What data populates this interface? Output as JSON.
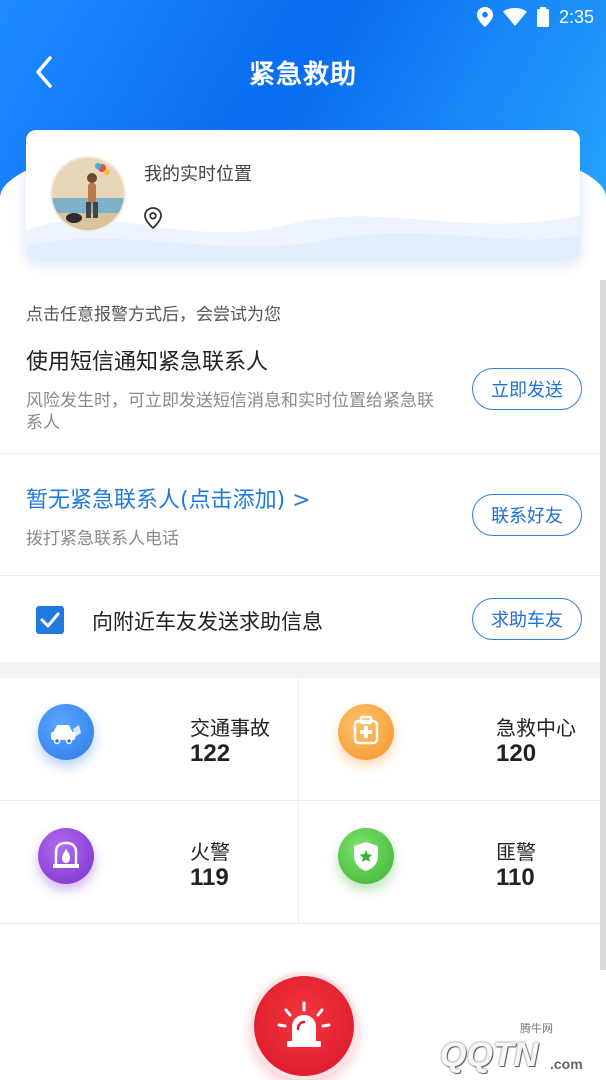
{
  "status_bar": {
    "time": "2:35",
    "icons": [
      "location-icon",
      "wifi-icon",
      "battery-icon"
    ]
  },
  "header": {
    "title": "紧急救助",
    "back_icon": "chevron-left-icon"
  },
  "location_card": {
    "title": "我的实时位置",
    "address": ""
  },
  "notice": "点击任意报警方式后，会尝试为您",
  "sms_row": {
    "title": "使用短信通知紧急联系人",
    "subtitle": "风险发生时，可立即发送短信消息和实时位置给紧急联系人",
    "button": "立即发送"
  },
  "contact_row": {
    "title": "暂无紧急联系人(点击添加)  >",
    "subtitle": "拨打紧急联系人电话",
    "button": "联系好友"
  },
  "nearby_row": {
    "checked": true,
    "label": "向附近车友发送求助信息",
    "button": "求助车友"
  },
  "services": [
    {
      "name": "交通事故",
      "number": "122",
      "icon": "car-accident-icon",
      "color": "#3a8ef0"
    },
    {
      "name": "急救中心",
      "number": "120",
      "icon": "first-aid-icon",
      "color": "#f6a13a"
    },
    {
      "name": "火警",
      "number": "119",
      "icon": "fire-icon",
      "color": "#8a3fd6"
    },
    {
      "name": "匪警",
      "number": "110",
      "icon": "police-badge-icon",
      "color": "#4fc44a"
    }
  ],
  "alarm_button": {
    "icon": "siren-icon",
    "color": "#e31b2d"
  },
  "watermark": {
    "text": "QQTN",
    "suffix": ".com",
    "small": "腾牛网"
  },
  "colors": {
    "primary": "#1f7ae0",
    "header": "#0a6cf0"
  }
}
